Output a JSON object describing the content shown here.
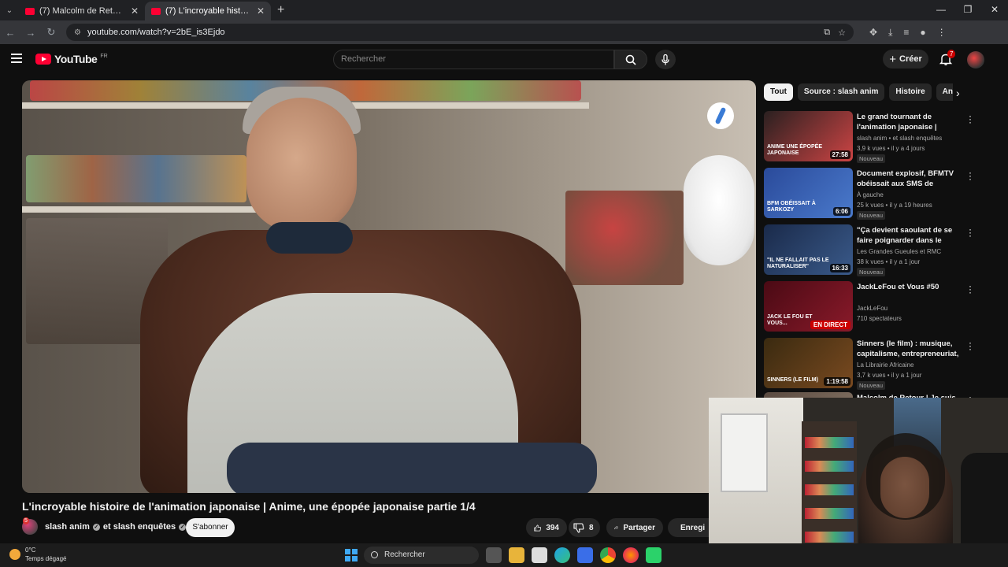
{
  "browser": {
    "tabs": [
      {
        "title": "(7) Malcolm de Retour ! Je suis",
        "active": false
      },
      {
        "title": "(7) L'incroyable histoire de l'ani",
        "active": true
      }
    ],
    "url": "youtube.com/watch?v=2bE_is3Ejdo"
  },
  "header": {
    "logo_text": "YouTube",
    "country": "FR",
    "search_placeholder": "Rechercher",
    "create_label": "Créer",
    "notification_count": "7"
  },
  "video": {
    "title": "L'incroyable histoire de l'animation japonaise | Anime, une épopée japonaise partie 1/4",
    "channel": "slash anim",
    "channel_and": "et slash enquêtes",
    "channel_badge": "5",
    "subscribe_label": "S'abonner",
    "likes": "394",
    "dislikes": "8",
    "share_label": "Partager",
    "save_label": "Enregi"
  },
  "chips": [
    "Tout",
    "Source : slash anim",
    "Histoire",
    "Anime"
  ],
  "recommendations": [
    {
      "title": "Le grand tournant de l'animation japonaise | Anime, ...",
      "channel": "slash anim • et slash enquêtes",
      "meta": "3,9 k vues • il y a 4 jours",
      "tag": "Nouveau",
      "duration": "27:58",
      "thumb_text": "ANIME UNE ÉPOPÉE JAPONAISE",
      "thumb_colors": [
        "#2a2020",
        "#c44"
      ]
    },
    {
      "title": "Document explosif, BFMTV obéissait aux SMS de Sarkozy",
      "channel": "À gauche",
      "meta": "25 k vues • il y a 19 heures",
      "tag": "Nouveau",
      "duration": "6:06",
      "thumb_text": "BFM OBÉISSAIT À SARKOZY",
      "thumb_colors": [
        "#2a4a9a",
        "#4a7acc"
      ]
    },
    {
      "title": "\"Ça devient saoulant de se faire poignarder dans le métro\"",
      "channel": "Les Grandes Gueules et RMC",
      "meta": "38 k vues • il y a 1 jour",
      "tag": "Nouveau",
      "duration": "16:33",
      "thumb_text": "\"IL NE FALLAIT PAS LE NATURALISER\"",
      "thumb_colors": [
        "#1a2a4a",
        "#3a5a8a"
      ]
    },
    {
      "title": "JackLeFou et Vous #50",
      "channel": "JackLeFou",
      "meta": "710 spectateurs",
      "tag": "",
      "duration": "",
      "live": "EN DIRECT",
      "thumb_text": "JACK LE FOU ET VOUS...",
      "thumb_colors": [
        "#4a0a14",
        "#8a1a2a"
      ]
    },
    {
      "title": "Sinners (le film) : musique, capitalisme, entrepreneuriat, ...",
      "channel": "La Librairie Africaine",
      "meta": "3,7 k vues • il y a 1 jour",
      "tag": "Nouveau",
      "duration": "1:19:58",
      "thumb_text": "SINNERS (LE FILM)",
      "thumb_colors": [
        "#3a2a10",
        "#7a4a20"
      ]
    },
    {
      "title": "Malcolm de Retour ! Je suis ...",
      "channel": "",
      "meta": "",
      "tag": "",
      "duration": "",
      "thumb_text": "",
      "thumb_colors": [
        "#5a4a40",
        "#8a7a6a"
      ]
    }
  ],
  "taskbar": {
    "temperature": "0°C",
    "weather": "Temps dégagé",
    "search_label": "Rechercher"
  }
}
